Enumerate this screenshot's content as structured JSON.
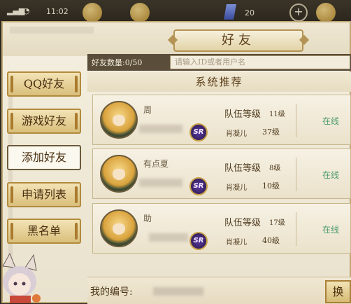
{
  "status_bar": {
    "time": "11:02",
    "currency": "20"
  },
  "title": "好友",
  "nav": {
    "items": [
      {
        "label": "QQ好友"
      },
      {
        "label": "游戏好友"
      },
      {
        "label": "添加好友",
        "active": true
      },
      {
        "label": "申请列表"
      },
      {
        "label": "黑名单"
      }
    ]
  },
  "friend_count": "好友数量:0/50",
  "search": {
    "placeholder": "请输入ID或者用户名"
  },
  "section_title": "系统推荐",
  "cards": [
    {
      "name": "周",
      "rank": "SR",
      "team_label": "队伍等级",
      "team_level": "11级",
      "char_name": "肖凝儿",
      "char_level": "37级",
      "status": "在线"
    },
    {
      "name": "有点夏",
      "rank": "SR",
      "team_label": "队伍等级",
      "team_level": "8级",
      "char_name": "肖凝儿",
      "char_level": "10级",
      "status": "在线"
    },
    {
      "name": "助",
      "rank": "SR",
      "team_label": "队伍等级",
      "team_level": "17级",
      "char_name": "肖凝儿",
      "char_level": "40级",
      "status": "在线"
    }
  ],
  "bottom": {
    "my_id_label": "我的编号:",
    "swap_label": "换"
  }
}
